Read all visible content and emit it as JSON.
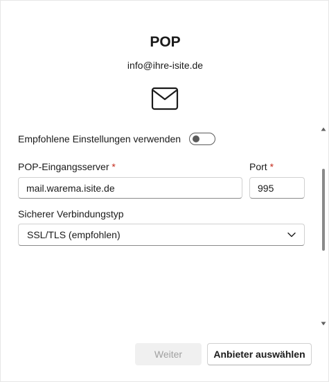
{
  "header": {
    "title": "POP",
    "email": "info@ihre-isite.de"
  },
  "icons": {
    "mail": "mail-envelope-icon",
    "chevron": "chevron-down-icon",
    "scroll_up": "scroll-up-arrow-icon",
    "scroll_down": "scroll-down-arrow-icon"
  },
  "recommended": {
    "label": "Empfohlene Einstellungen verwenden",
    "enabled": false
  },
  "incoming_server": {
    "label": "POP-Eingangsserver",
    "required_mark": "*",
    "value": "mail.warema.isite.de"
  },
  "port": {
    "label": "Port",
    "required_mark": "*",
    "value": "995"
  },
  "connection_type": {
    "label": "Sicherer Verbindungstyp",
    "selected": "SSL/TLS (empfohlen)"
  },
  "buttons": {
    "next": "Weiter",
    "choose_provider": "Anbieter auswählen"
  },
  "colors": {
    "required": "#c42b1c",
    "disabled_button_bg": "#f0f0f0",
    "disabled_button_text": "#a0a0a0"
  }
}
